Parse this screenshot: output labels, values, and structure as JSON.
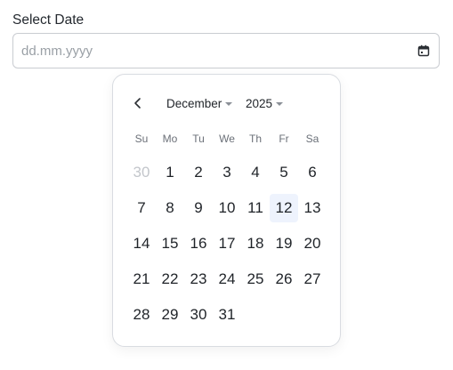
{
  "field": {
    "label": "Select Date",
    "placeholder": "dd.mm.yyyy"
  },
  "calendar": {
    "month": "December",
    "year": "2025",
    "weekdays": [
      "Su",
      "Mo",
      "Tu",
      "We",
      "Th",
      "Fr",
      "Sa"
    ],
    "days": [
      {
        "label": "30",
        "outside": true
      },
      {
        "label": "1"
      },
      {
        "label": "2"
      },
      {
        "label": "3"
      },
      {
        "label": "4"
      },
      {
        "label": "5"
      },
      {
        "label": "6"
      },
      {
        "label": "7"
      },
      {
        "label": "8"
      },
      {
        "label": "9"
      },
      {
        "label": "10"
      },
      {
        "label": "11"
      },
      {
        "label": "12",
        "today": true
      },
      {
        "label": "13"
      },
      {
        "label": "14"
      },
      {
        "label": "15"
      },
      {
        "label": "16"
      },
      {
        "label": "17"
      },
      {
        "label": "18"
      },
      {
        "label": "19"
      },
      {
        "label": "20"
      },
      {
        "label": "21"
      },
      {
        "label": "22"
      },
      {
        "label": "23"
      },
      {
        "label": "24"
      },
      {
        "label": "25"
      },
      {
        "label": "26"
      },
      {
        "label": "27"
      },
      {
        "label": "28"
      },
      {
        "label": "29"
      },
      {
        "label": "30"
      },
      {
        "label": "31"
      }
    ]
  },
  "colors": {
    "today_highlight": "#eef3fd",
    "outside_day": "#c3c6cb",
    "border": "#c9ccd1"
  },
  "icons": {
    "calendar": "calendar-icon",
    "prev": "chevron-left-icon",
    "caret": "caret-down-icon"
  }
}
